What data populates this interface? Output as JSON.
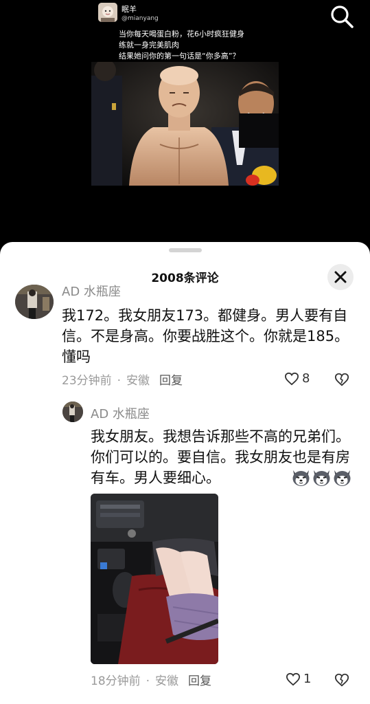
{
  "video": {
    "author_name": "眠羊",
    "author_handle": "@mianyang",
    "caption_lines": [
      "当你每天喝蛋白粉，花6小时疯狂健身",
      "练就一身完美肌肉",
      "结果她问你的第一句话是“你多高”？"
    ]
  },
  "sheet": {
    "title": "2008条评论"
  },
  "comments": [
    {
      "name": "AD 水瓶座",
      "text": "我172。我女朋友173。都健身。男人要有自信。不是身高。你要战胜这个。你就是185。懂吗",
      "time": "23分钟前",
      "location": "安徽",
      "reply": "回复",
      "likes": "8"
    },
    {
      "name": "AD 水瓶座",
      "text": "我女朋友。我想告诉那些不高的兄弟们。你们可以的。要自信。我女朋友也是有房有车。男人要细心。",
      "time": "18分钟前",
      "location": "安徽",
      "reply": "回复",
      "likes": "1"
    }
  ],
  "icons": {
    "search": "search-icon",
    "close": "close-icon",
    "like": "heart-icon",
    "dislike": "broken-heart-icon",
    "emoji": "husky-dog-emoji"
  },
  "colors": {
    "sheet_bg": "#ffffff",
    "meta_gray": "#9a9a9a",
    "text": "#111111"
  }
}
